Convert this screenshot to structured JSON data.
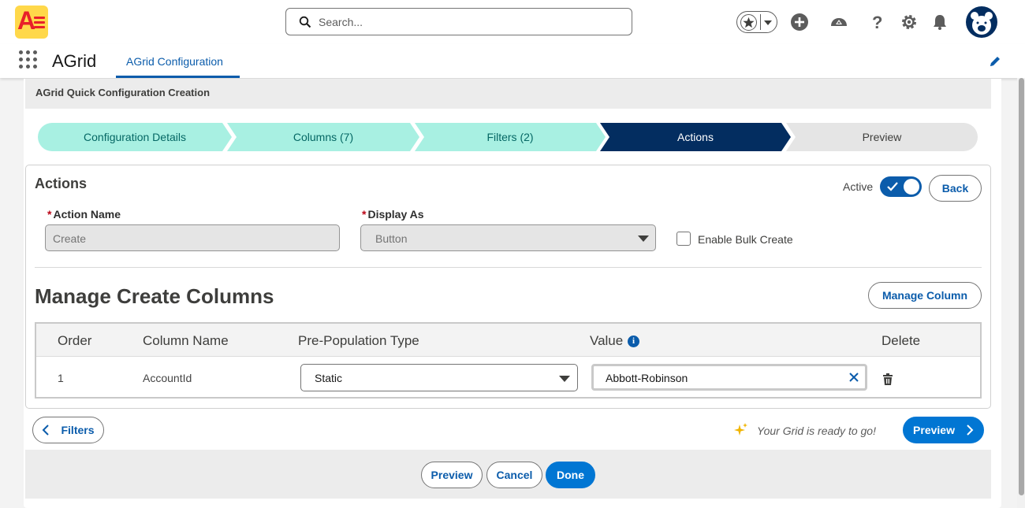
{
  "header": {
    "search_placeholder": "Search...",
    "icons": [
      "favorites-star-icon",
      "add-icon",
      "trailhead-icon",
      "help-icon",
      "setup-gear-icon",
      "notifications-bell-icon",
      "user-avatar"
    ]
  },
  "nav": {
    "app_name": "AGrid",
    "tab_label": "AGrid Configuration"
  },
  "page": {
    "title": "AGrid Quick Configuration Creation"
  },
  "path": {
    "steps": [
      {
        "label": "Configuration Details",
        "state": "complete"
      },
      {
        "label": "Columns (7)",
        "state": "complete"
      },
      {
        "label": "Filters (2)",
        "state": "complete"
      },
      {
        "label": "Actions",
        "state": "current"
      },
      {
        "label": "Preview",
        "state": "incomplete"
      }
    ]
  },
  "actions": {
    "title": "Actions",
    "active_label": "Active",
    "active": true,
    "back_label": "Back",
    "action_name_label": "Action Name",
    "action_name_value": "Create",
    "display_as_label": "Display As",
    "display_as_value": "Button",
    "bulk_label": "Enable Bulk Create",
    "bulk_checked": false
  },
  "manage": {
    "title": "Manage Create Columns",
    "manage_button": "Manage Column",
    "columns": [
      "Order",
      "Column Name",
      "Pre-Population Type",
      "Value",
      "Delete"
    ],
    "rows": [
      {
        "order": "1",
        "column_name": "AccountId",
        "type": "Static",
        "value": "Abbott-Robinson"
      }
    ]
  },
  "nav_buttons": {
    "filters": "Filters",
    "ready_text": "Your Grid is ready to go!",
    "preview": "Preview"
  },
  "footer": {
    "preview": "Preview",
    "cancel": "Cancel",
    "done": "Done"
  },
  "colors": {
    "brand": "#0176d3",
    "complete_step": "#a8f0e2",
    "current_step": "#032d60",
    "incomplete_step": "#e5e5e5"
  }
}
